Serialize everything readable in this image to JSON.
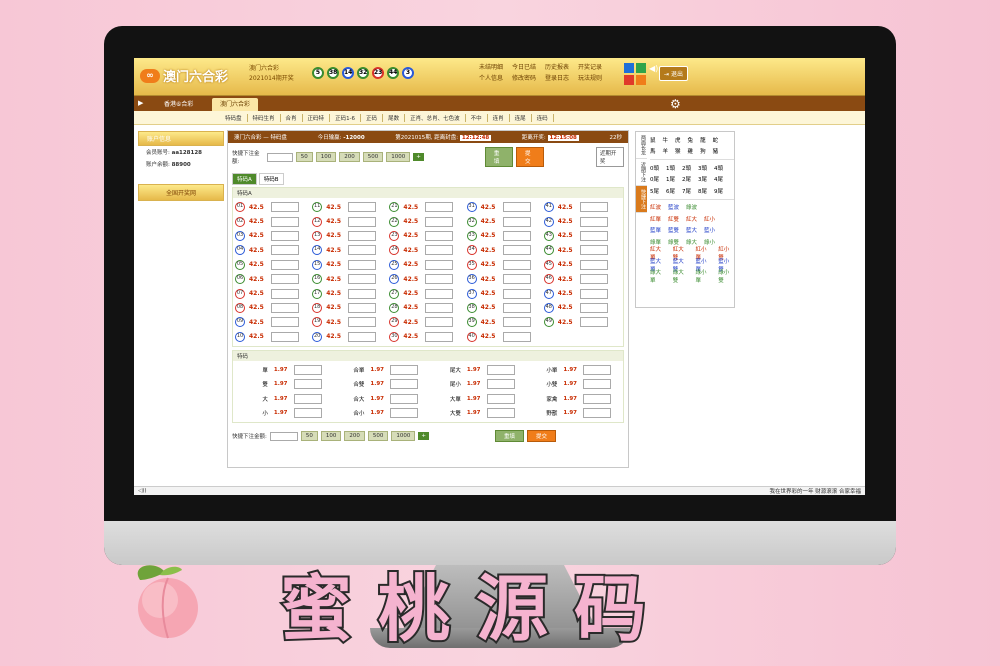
{
  "brand": {
    "logo_mark": "∞",
    "title": "澳门六合彩"
  },
  "draw": {
    "line1": "澳门六合彩",
    "line2": "2021014期开奖",
    "balls": [
      "5",
      "38",
      "14",
      "32",
      "23",
      "44",
      "3"
    ]
  },
  "toplinks": [
    "未结明细",
    "今日已结",
    "历史报表",
    "开奖记录",
    "个人信息",
    "修改密码",
    "登录日志",
    "玩法规则"
  ],
  "colors": {
    "c1": "#1e6fd8",
    "c2": "#2fa44a",
    "c3": "#e03a2a",
    "c4": "#f07d1a"
  },
  "exit_label": "退出",
  "nav": {
    "tab1": "香港⑥合彩",
    "tab2": "澳门六合彩"
  },
  "subnav": [
    "特码盘",
    "特码生肖",
    "合肖",
    "正码特",
    "正码1-6",
    "正码",
    "尾数",
    "正肖、总肖、七色波",
    "不中",
    "连肖",
    "连尾",
    "连码"
  ],
  "sidebar": {
    "head": "账户信息",
    "account_label": "会员账号:",
    "account": "aa128128",
    "balance_label": "账户余额:",
    "balance": "88900",
    "open_btn": "全国开奖网"
  },
  "main_head": {
    "title": "澳门六合彩 — 特码盘",
    "today_label": "今日输赢:",
    "today": "-12000",
    "period_label": "第2021015期, 距离封盘:",
    "close_time": "12:12:48",
    "open_label": "距离开奖:",
    "open_time": "12:15:08",
    "seconds": "22秒"
  },
  "quick": {
    "label": "快捷下注金额:",
    "amounts": [
      "50",
      "100",
      "200",
      "500",
      "1000"
    ],
    "plus": "+",
    "reset": "重填",
    "submit": "提交",
    "recent": "近期开奖"
  },
  "subtabs": [
    "特码A",
    "特码B"
  ],
  "grid_title": "特码A",
  "odds": "42.5",
  "attr_title": "特码",
  "attr": [
    [
      {
        "name": "單",
        "odds": "1.97"
      },
      {
        "name": "合單",
        "odds": "1.97"
      },
      {
        "name": "尾大",
        "odds": "1.97"
      },
      {
        "name": "小單",
        "odds": "1.97"
      }
    ],
    [
      {
        "name": "雙",
        "odds": "1.97"
      },
      {
        "name": "合雙",
        "odds": "1.97"
      },
      {
        "name": "尾小",
        "odds": "1.97"
      },
      {
        "name": "小雙",
        "odds": "1.97"
      }
    ],
    [
      {
        "name": "大",
        "odds": "1.97"
      },
      {
        "name": "合大",
        "odds": "1.97"
      },
      {
        "name": "大單",
        "odds": "1.97"
      },
      {
        "name": "家禽",
        "odds": "1.97"
      }
    ],
    [
      {
        "name": "小",
        "odds": "1.97"
      },
      {
        "name": "合小",
        "odds": "1.97"
      },
      {
        "name": "大雙",
        "odds": "1.97"
      },
      {
        "name": "野獸",
        "odds": "1.97"
      }
    ]
  ],
  "right_tabs": [
    "两面长龙",
    "近期下注",
    "快捷下注"
  ],
  "zodiac": [
    [
      "鼠",
      "牛",
      "虎",
      "兔",
      "龍",
      "蛇"
    ],
    [
      "馬",
      "羊",
      "猴",
      "雞",
      "狗",
      "豬"
    ]
  ],
  "heads": [
    [
      "0頭",
      "1頭",
      "2頭",
      "3頭",
      "4頭"
    ],
    [
      "0尾",
      "1尾",
      "2尾",
      "3尾",
      "4尾"
    ],
    [
      "5尾",
      "6尾",
      "7尾",
      "8尾",
      "9尾"
    ]
  ],
  "waves": [
    [
      "紅波",
      "藍波",
      "綠波"
    ],
    [
      "紅單",
      "紅雙",
      "紅大",
      "紅小"
    ],
    [
      "藍單",
      "藍雙",
      "藍大",
      "藍小"
    ],
    [
      "綠單",
      "綠雙",
      "綠大",
      "綠小"
    ],
    [
      "紅大單",
      "紅大雙",
      "紅小單",
      "紅小雙"
    ],
    [
      "藍大單",
      "藍大雙",
      "藍小單",
      "藍小雙"
    ],
    [
      "綠大單",
      "綠大雙",
      "綠小單",
      "綠小雙"
    ]
  ],
  "footer": {
    "marquee": "我在世界彩的一年 财源滚滚 合家幸福"
  },
  "overlay": {
    "chars": [
      "蜜",
      "桃",
      "源",
      "码"
    ]
  }
}
